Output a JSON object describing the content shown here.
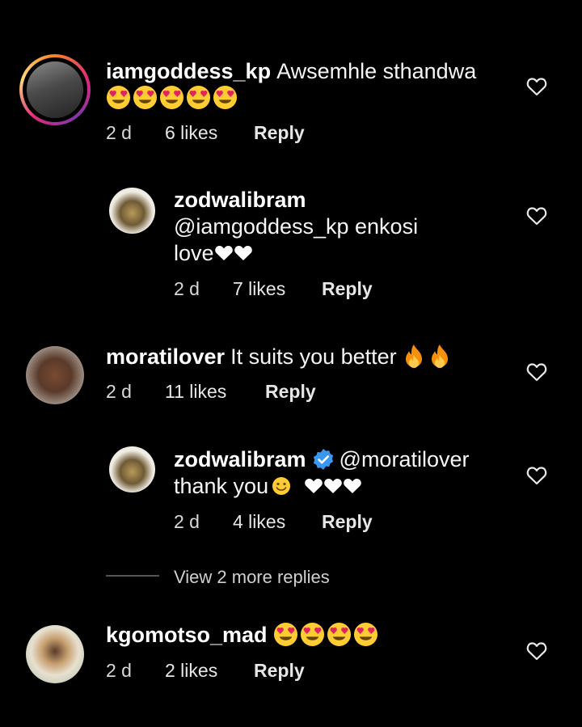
{
  "comments": [
    {
      "username": "iamgoddess_kp",
      "text": "Awsemhle sthandwa",
      "emojis": [
        "heart-eyes",
        "heart-eyes",
        "heart-eyes",
        "heart-eyes",
        "heart-eyes"
      ],
      "time": "2 d",
      "likes": "6 likes",
      "reply": "Reply"
    },
    {
      "username": "zodwalibram",
      "text": "@iamgoddess_kp enkosi",
      "text2": "love",
      "time": "2 d",
      "likes": "7 likes",
      "reply": "Reply"
    },
    {
      "username": "moratilover",
      "text": "It suits you better",
      "time": "2 d",
      "likes": "11 likes",
      "reply": "Reply"
    },
    {
      "username": "zodwalibram",
      "mention": "@moratilover",
      "text2": "thank you",
      "time": "2 d",
      "likes": "4 likes",
      "reply": "Reply"
    },
    {
      "username": "kgomotso_mad",
      "time": "2 d",
      "likes": "2 likes",
      "reply": "Reply"
    }
  ],
  "view_more": "View 2 more replies",
  "colors": {
    "background": "#000000",
    "verified": "#3897f0",
    "emoji_face": "#ffcc33",
    "emoji_heart": "#e0245e",
    "fire": "#f4900c"
  },
  "icons": [
    "heart-outline-icon",
    "verified-badge-icon",
    "heart-eyes-emoji",
    "fire-emoji",
    "smile-emoji",
    "black-heart-emoji"
  ]
}
